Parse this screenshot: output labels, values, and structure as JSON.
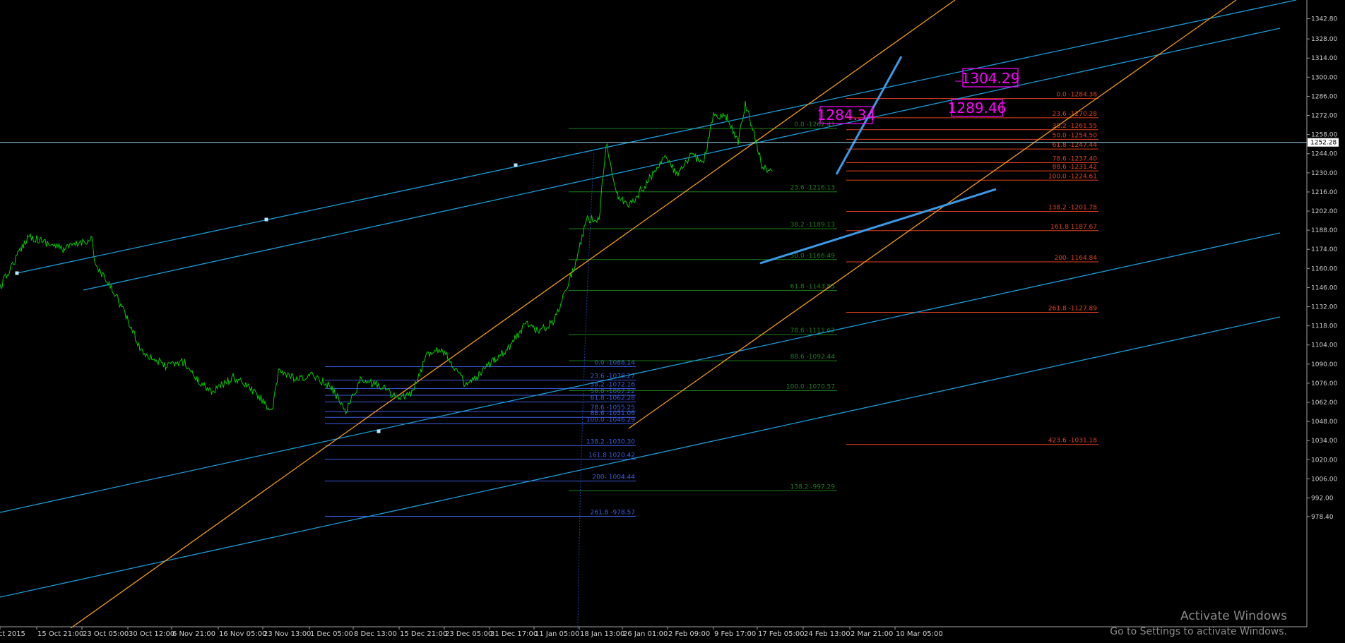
{
  "chart_data": {
    "type": "line",
    "title": "",
    "xlabel": "",
    "ylabel": "",
    "ylim": [
      973,
      1351
    ],
    "background": "#000000",
    "colors": {
      "price": "#00cc00",
      "axis": "#a0a0a0",
      "channel_blue": "#1a9bd6",
      "channel_orange": "#f29a1e",
      "fib_red": "#e0401e",
      "fib_green": "#1b7f1b",
      "fib_blue": "#3b5ce0",
      "label_magenta": "#ff00ff",
      "trend_blue": "#3a9ae8"
    },
    "y_ticks": [
      "1342.80",
      "1328.00",
      "1314.00",
      "1300.00",
      "1286.00",
      "1272.00",
      "1258.00",
      "1244.00",
      "1230.00",
      "1216.00",
      "1202.00",
      "1188.00",
      "1174.00",
      "1160.00",
      "1146.00",
      "1132.00",
      "1118.00",
      "1104.00",
      "1090.00",
      "1076.00",
      "1062.00",
      "1048.00",
      "1034.00",
      "1020.00",
      "1006.00",
      "992.00",
      "978.40"
    ],
    "current_price": "1252.28",
    "x_ticks": [
      "Oct 2015",
      "15 Oct 21:00",
      "23 Oct 05:00",
      "30 Oct 12:00",
      "6 Nov 21:00",
      "16 Nov 05:00",
      "23 Nov 13:00",
      "1 Dec 05:00",
      "8 Dec 13:00",
      "15 Dec 21:00",
      "23 Dec 05:00",
      "31 Dec 17:00",
      "11 Jan 05:00",
      "18 Jan 13:00",
      "26 Jan 01:00",
      "2 Feb 09:00",
      "9 Feb 17:00",
      "17 Feb 05:00",
      "24 Feb 13:00",
      "2 Mar 21:00",
      "10 Mar 05:00"
    ],
    "price_anchors": [
      [
        0,
        1146
      ],
      [
        40,
        1184
      ],
      [
        90,
        1174
      ],
      [
        130,
        1182
      ],
      [
        135,
        1162
      ],
      [
        165,
        1140
      ],
      [
        200,
        1100
      ],
      [
        235,
        1088
      ],
      [
        260,
        1092
      ],
      [
        280,
        1078
      ],
      [
        300,
        1070
      ],
      [
        330,
        1080
      ],
      [
        350,
        1074
      ],
      [
        375,
        1062
      ],
      [
        385,
        1054
      ],
      [
        395,
        1086
      ],
      [
        420,
        1078
      ],
      [
        445,
        1082
      ],
      [
        470,
        1072
      ],
      [
        490,
        1056
      ],
      [
        510,
        1078
      ],
      [
        540,
        1074
      ],
      [
        565,
        1064
      ],
      [
        585,
        1070
      ],
      [
        605,
        1098
      ],
      [
        625,
        1102
      ],
      [
        645,
        1086
      ],
      [
        660,
        1074
      ],
      [
        680,
        1082
      ],
      [
        700,
        1094
      ],
      [
        720,
        1102
      ],
      [
        745,
        1120
      ],
      [
        765,
        1114
      ],
      [
        785,
        1122
      ],
      [
        800,
        1144
      ],
      [
        815,
        1164
      ],
      [
        830,
        1196
      ],
      [
        848,
        1196
      ],
      [
        858,
        1252
      ],
      [
        875,
        1212
      ],
      [
        890,
        1206
      ],
      [
        915,
        1222
      ],
      [
        940,
        1242
      ],
      [
        960,
        1228
      ],
      [
        980,
        1244
      ],
      [
        995,
        1236
      ],
      [
        1010,
        1272
      ],
      [
        1030,
        1270
      ],
      [
        1045,
        1252
      ],
      [
        1055,
        1280
      ],
      [
        1068,
        1258
      ],
      [
        1080,
        1232
      ],
      [
        1094,
        1234
      ]
    ],
    "fib_sets": [
      {
        "color_key": "fib_blue",
        "levels": [
          {
            "label": "0.0 -1088.14",
            "value": 1088.14
          },
          {
            "label": "23.6 -1078.27",
            "value": 1078.27
          },
          {
            "label": "38.2 -1072.16",
            "value": 1072.16
          },
          {
            "label": "50.0 -1067.22",
            "value": 1067.22
          },
          {
            "label": "61.8 -1062.28",
            "value": 1062.28
          },
          {
            "label": "78.6 -1055.25",
            "value": 1055.25
          },
          {
            "label": "88.6 -1051.06",
            "value": 1051.06
          },
          {
            "label": "100.0 -1046.29",
            "value": 1046.29
          },
          {
            "label": "138.2 -1030.30",
            "value": 1030.3
          },
          {
            "label": "161.8 1020.42",
            "value": 1020.42
          },
          {
            "label": "200- 1004.44",
            "value": 1004.44
          },
          {
            "label": "261.8 -978.57",
            "value": 978.57
          }
        ]
      },
      {
        "color_key": "fib_green",
        "levels": [
          {
            "label": "0.0 -1262.41",
            "value": 1262.41
          },
          {
            "label": "23.6 -1216.13",
            "value": 1216.13
          },
          {
            "label": "38.2 -1189.13",
            "value": 1189.13
          },
          {
            "label": "50.0 -1166.49",
            "value": 1166.49
          },
          {
            "label": "61.8 -1143.85",
            "value": 1143.85
          },
          {
            "label": "78.6 -1111.62",
            "value": 1111.62
          },
          {
            "label": "88.6 -1092.44",
            "value": 1092.44
          },
          {
            "label": "100.0 -1070.57",
            "value": 1070.57
          },
          {
            "label": "138.2 -997.29",
            "value": 997.29
          }
        ]
      },
      {
        "color_key": "fib_red",
        "levels": [
          {
            "label": "0.0 -1284.38",
            "value": 1284.38
          },
          {
            "label": "23.6 -1270.28",
            "value": 1270.28
          },
          {
            "label": "38.2 -1261.55",
            "value": 1261.55
          },
          {
            "label": "50.0 -1254.50",
            "value": 1254.5
          },
          {
            "label": "61.8 -1247.44",
            "value": 1247.44
          },
          {
            "label": "78.6 -1237.40",
            "value": 1237.4
          },
          {
            "label": "88.6 -1231.42",
            "value": 1231.42
          },
          {
            "label": "100.0 -1224.61",
            "value": 1224.61
          },
          {
            "label": "138.2 -1201.78",
            "value": 1201.78
          },
          {
            "label": "161.8 1187.67",
            "value": 1187.67
          },
          {
            "label": "200- 1164.84",
            "value": 1164.84
          },
          {
            "label": "261.8 -1127.89",
            "value": 1127.89
          },
          {
            "label": "423.6 -1031.18",
            "value": 1031.18
          }
        ]
      }
    ],
    "price_labels": [
      "1304.29",
      "1289.46",
      "1284.34"
    ]
  },
  "watermark": {
    "title": "Activate Windows",
    "subtitle": "Go to Settings to activate Windows."
  }
}
